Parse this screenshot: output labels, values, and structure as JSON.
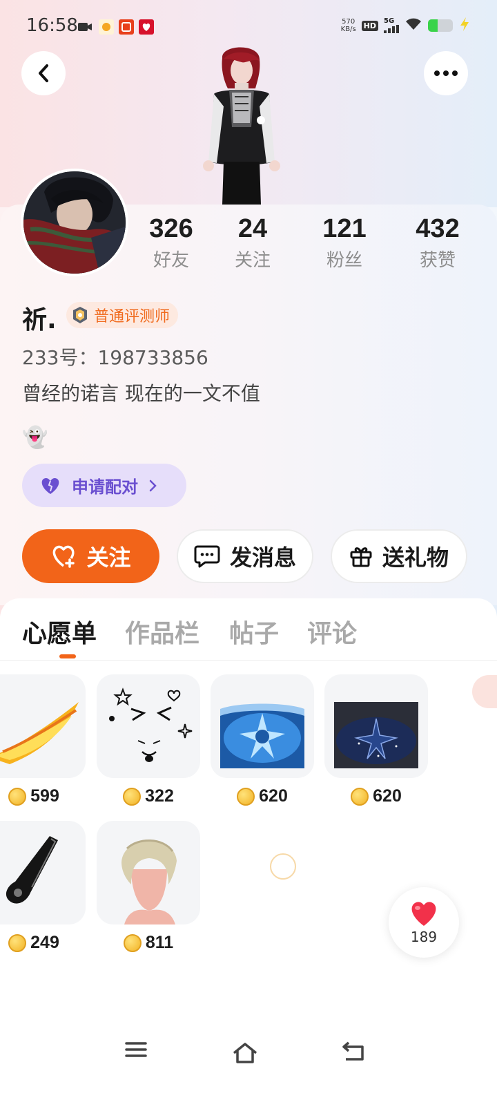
{
  "status_bar": {
    "time": "16:58",
    "net_speed_value": "570",
    "net_speed_unit": "KB/s",
    "hd": "HD",
    "signal": "5G"
  },
  "header": {
    "back_icon": "chevron-left-icon",
    "more_icon": "more-dots-icon"
  },
  "stats": [
    {
      "value": "326",
      "label": "好友"
    },
    {
      "value": "24",
      "label": "关注"
    },
    {
      "value": "121",
      "label": "粉丝"
    },
    {
      "value": "432",
      "label": "获赞"
    }
  ],
  "profile": {
    "name": "祈.",
    "badge": "普通评测师",
    "uid": "233号：198733856",
    "bio": "曾经的诺言 现在的一文不值",
    "emoji": "👻"
  },
  "pair_button": {
    "label": "申请配对",
    "icon": "purple-heart-icon"
  },
  "actions": {
    "follow": "关注",
    "message": "发消息",
    "gift": "送礼物"
  },
  "tabs": [
    {
      "label": "心愿单",
      "active": true
    },
    {
      "label": "作品栏",
      "active": false
    },
    {
      "label": "帖子",
      "active": false
    },
    {
      "label": "评论",
      "active": false
    }
  ],
  "wishlist": [
    {
      "price": "599",
      "thumb": "fire-wing"
    },
    {
      "price": "322",
      "thumb": "doodle-face"
    },
    {
      "price": "620",
      "thumb": "blue-snowflake-crown"
    },
    {
      "price": "620",
      "thumb": "dark-star-crown"
    },
    {
      "price": "249",
      "thumb": "black-guitar"
    },
    {
      "price": "811",
      "thumb": "blonde-hair"
    }
  ],
  "like_fab": {
    "count": "189"
  },
  "colors": {
    "accent": "#f26419",
    "pair_bg": "#e6defa",
    "pair_text": "#6a4fd0"
  }
}
